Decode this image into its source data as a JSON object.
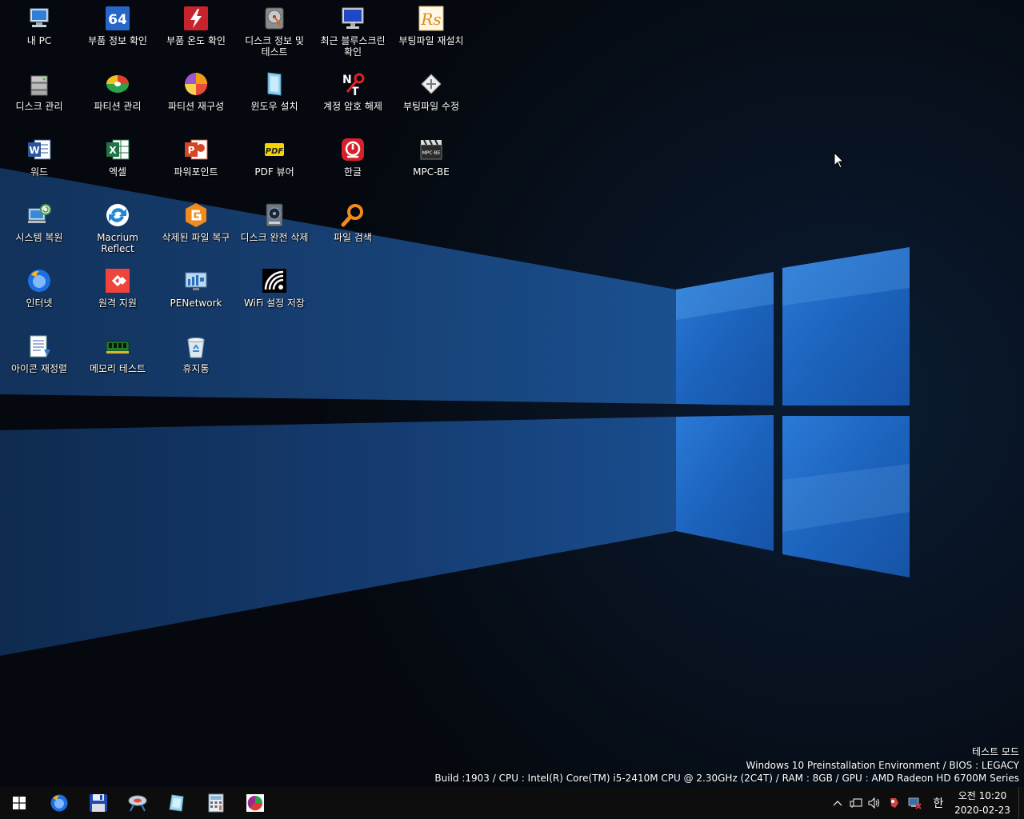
{
  "desktop": {
    "icons": [
      {
        "label": "내 PC",
        "icon": "computer-icon"
      },
      {
        "label": "부품 정보 확인",
        "icon": "aida64-icon"
      },
      {
        "label": "부품 온도 확인",
        "icon": "temperature-icon"
      },
      {
        "label": "디스크 정보 및\n테스트",
        "icon": "hard-disk-icon"
      },
      {
        "label": "최근 블루스크린\n확인",
        "icon": "monitor-icon"
      },
      {
        "label": "부팅파일 재설치",
        "icon": "rs-icon"
      },
      {
        "label": "디스크 관리",
        "icon": "disk-management-icon"
      },
      {
        "label": "파티션 관리",
        "icon": "partition-manager-icon"
      },
      {
        "label": "파티션 재구성",
        "icon": "pie-chart-icon"
      },
      {
        "label": "윈도우 설치",
        "icon": "windows-setup-icon"
      },
      {
        "label": "계정 암호 해제",
        "icon": "nt-password-icon"
      },
      {
        "label": "부팅파일 수정",
        "icon": "boot-edit-icon"
      },
      {
        "label": "워드",
        "icon": "word-icon"
      },
      {
        "label": "엑셀",
        "icon": "excel-icon"
      },
      {
        "label": "파워포인트",
        "icon": "powerpoint-icon"
      },
      {
        "label": "PDF 뷰어",
        "icon": "pdf-icon"
      },
      {
        "label": "한글",
        "icon": "hangul-icon"
      },
      {
        "label": "MPC-BE",
        "icon": "mpc-be-icon"
      },
      {
        "label": "시스템 복원",
        "icon": "system-restore-icon"
      },
      {
        "label": "Macrium Reflect",
        "icon": "macrium-reflect-icon"
      },
      {
        "label": "삭제된 파일 복구",
        "icon": "recovery-icon"
      },
      {
        "label": "디스크 완전 삭제",
        "icon": "disk-wipe-icon"
      },
      {
        "label": "파일 검색",
        "icon": "search-icon"
      },
      {
        "label": "인터넷",
        "icon": "firefox-icon"
      },
      {
        "label": "원격 지원",
        "icon": "anydesk-icon"
      },
      {
        "label": "PENetwork",
        "icon": "network-icon"
      },
      {
        "label": "WiFi 설정 저장",
        "icon": "wifi-icon"
      },
      {
        "label": "아이콘 재정렬",
        "icon": "icon-arrange-icon"
      },
      {
        "label": "메모리 테스트",
        "icon": "memory-icon"
      },
      {
        "label": "휴지통",
        "icon": "recycle-bin-icon"
      }
    ]
  },
  "watermark": {
    "line1": "테스트 모드",
    "line2": "Windows 10 Preinstallation Environment / BIOS : LEGACY",
    "line3": "Build  :1903 / CPU : Intel(R) Core(TM) i5-2410M CPU @ 2.30GHz (2C4T) / RAM : 8GB / GPU : AMD Radeon HD 6700M Series"
  },
  "taskbar": {
    "start_icon": "windows-logo-icon",
    "pinned": [
      "firefox-icon",
      "save-icon",
      "network-tool-icon",
      "setup-icon",
      "calculator-icon",
      "chart-app-icon"
    ],
    "tray": {
      "ime": "한",
      "time": "오전 10:20",
      "date": "2020-02-23"
    }
  },
  "colors": {
    "wallpaper_blue": "#1e5ba8",
    "taskbar_bg": "#0d0d0d"
  }
}
